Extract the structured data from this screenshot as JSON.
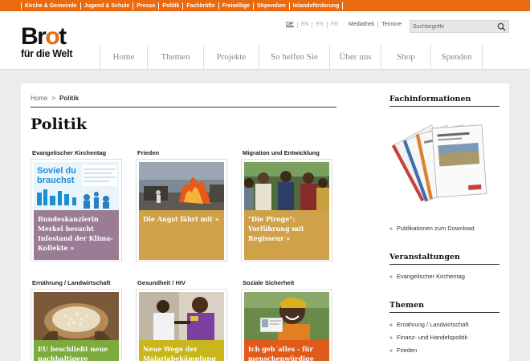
{
  "topbar": {
    "items": [
      "Kirche & Gemeinde",
      "Jugend & Schule",
      "Presse",
      "Politik",
      "Fachkräfte",
      "Freiwillige",
      "Stipendien",
      "Inlandsförderung"
    ]
  },
  "logo": {
    "line1_b": "Br",
    "line1_o": "o",
    "line1_t": "t",
    "line2": "für die Welt"
  },
  "languages": [
    "DE",
    "EN",
    "ES",
    "FR"
  ],
  "utility": [
    "Mediathek",
    "Termine"
  ],
  "search": {
    "placeholder": "Suchbegriffe"
  },
  "mainnav": [
    "Home",
    "Themen",
    "Projekte",
    "So helfen Sie",
    "Über uns",
    "Shop",
    "Spenden"
  ],
  "breadcrumb": {
    "home": "Home",
    "separator": ">",
    "current": "Politik"
  },
  "page_title": "Politik",
  "tiles": [
    {
      "label": "Evangelischer Kirchentag",
      "caption": "Bundeskanzlerin Merkel besucht Infostand der Klima-Kollekte »",
      "color": "#9a7d95",
      "poster_line1": "Soviel du",
      "poster_line2": "brauchst"
    },
    {
      "label": "Frieden",
      "caption": "Die Angst fährt mit »",
      "color": "#cfa24a"
    },
    {
      "label": "Migration und Entwicklung",
      "caption": "\"Die Piroge\": Vorführung mit Regisseur »",
      "color": "#cfa24a"
    },
    {
      "label": "Ernährung / Landwirtschaft",
      "caption": "EU beschließt neue nachhaltigere",
      "color": "#7dab3d"
    },
    {
      "label": "Gesundheit / HIV",
      "caption": "Neue Wege der Malariabekämpfung",
      "color": "#c8b61a"
    },
    {
      "label": "Soziale Sicherheit",
      "caption": "Ich geb´alles - für menschenwürdige",
      "color": "#e05a1a"
    }
  ],
  "sidebar": {
    "fach_title": "Fachinformationen",
    "fach_link": "Publikationen zum Download",
    "events_title": "Veranstaltungen",
    "events_items": [
      "Evangelischer Kirchentag"
    ],
    "themen_title": "Themen",
    "themen_items": [
      "Ernährung / Landwirtschaft",
      "Finanz- und Handelspolitik",
      "Frieden"
    ]
  },
  "colors": {
    "brand_orange": "#ea6a10"
  }
}
